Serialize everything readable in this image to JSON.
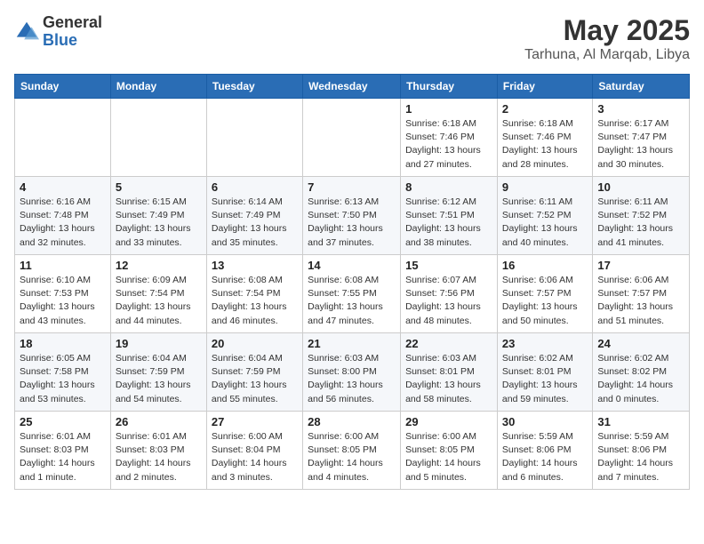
{
  "header": {
    "logo_general": "General",
    "logo_blue": "Blue",
    "title": "May 2025",
    "location": "Tarhuna, Al Marqab, Libya"
  },
  "weekdays": [
    "Sunday",
    "Monday",
    "Tuesday",
    "Wednesday",
    "Thursday",
    "Friday",
    "Saturday"
  ],
  "weeks": [
    [
      {
        "day": "",
        "info": ""
      },
      {
        "day": "",
        "info": ""
      },
      {
        "day": "",
        "info": ""
      },
      {
        "day": "",
        "info": ""
      },
      {
        "day": "1",
        "info": "Sunrise: 6:18 AM\nSunset: 7:46 PM\nDaylight: 13 hours\nand 27 minutes."
      },
      {
        "day": "2",
        "info": "Sunrise: 6:18 AM\nSunset: 7:46 PM\nDaylight: 13 hours\nand 28 minutes."
      },
      {
        "day": "3",
        "info": "Sunrise: 6:17 AM\nSunset: 7:47 PM\nDaylight: 13 hours\nand 30 minutes."
      }
    ],
    [
      {
        "day": "4",
        "info": "Sunrise: 6:16 AM\nSunset: 7:48 PM\nDaylight: 13 hours\nand 32 minutes."
      },
      {
        "day": "5",
        "info": "Sunrise: 6:15 AM\nSunset: 7:49 PM\nDaylight: 13 hours\nand 33 minutes."
      },
      {
        "day": "6",
        "info": "Sunrise: 6:14 AM\nSunset: 7:49 PM\nDaylight: 13 hours\nand 35 minutes."
      },
      {
        "day": "7",
        "info": "Sunrise: 6:13 AM\nSunset: 7:50 PM\nDaylight: 13 hours\nand 37 minutes."
      },
      {
        "day": "8",
        "info": "Sunrise: 6:12 AM\nSunset: 7:51 PM\nDaylight: 13 hours\nand 38 minutes."
      },
      {
        "day": "9",
        "info": "Sunrise: 6:11 AM\nSunset: 7:52 PM\nDaylight: 13 hours\nand 40 minutes."
      },
      {
        "day": "10",
        "info": "Sunrise: 6:11 AM\nSunset: 7:52 PM\nDaylight: 13 hours\nand 41 minutes."
      }
    ],
    [
      {
        "day": "11",
        "info": "Sunrise: 6:10 AM\nSunset: 7:53 PM\nDaylight: 13 hours\nand 43 minutes."
      },
      {
        "day": "12",
        "info": "Sunrise: 6:09 AM\nSunset: 7:54 PM\nDaylight: 13 hours\nand 44 minutes."
      },
      {
        "day": "13",
        "info": "Sunrise: 6:08 AM\nSunset: 7:54 PM\nDaylight: 13 hours\nand 46 minutes."
      },
      {
        "day": "14",
        "info": "Sunrise: 6:08 AM\nSunset: 7:55 PM\nDaylight: 13 hours\nand 47 minutes."
      },
      {
        "day": "15",
        "info": "Sunrise: 6:07 AM\nSunset: 7:56 PM\nDaylight: 13 hours\nand 48 minutes."
      },
      {
        "day": "16",
        "info": "Sunrise: 6:06 AM\nSunset: 7:57 PM\nDaylight: 13 hours\nand 50 minutes."
      },
      {
        "day": "17",
        "info": "Sunrise: 6:06 AM\nSunset: 7:57 PM\nDaylight: 13 hours\nand 51 minutes."
      }
    ],
    [
      {
        "day": "18",
        "info": "Sunrise: 6:05 AM\nSunset: 7:58 PM\nDaylight: 13 hours\nand 53 minutes."
      },
      {
        "day": "19",
        "info": "Sunrise: 6:04 AM\nSunset: 7:59 PM\nDaylight: 13 hours\nand 54 minutes."
      },
      {
        "day": "20",
        "info": "Sunrise: 6:04 AM\nSunset: 7:59 PM\nDaylight: 13 hours\nand 55 minutes."
      },
      {
        "day": "21",
        "info": "Sunrise: 6:03 AM\nSunset: 8:00 PM\nDaylight: 13 hours\nand 56 minutes."
      },
      {
        "day": "22",
        "info": "Sunrise: 6:03 AM\nSunset: 8:01 PM\nDaylight: 13 hours\nand 58 minutes."
      },
      {
        "day": "23",
        "info": "Sunrise: 6:02 AM\nSunset: 8:01 PM\nDaylight: 13 hours\nand 59 minutes."
      },
      {
        "day": "24",
        "info": "Sunrise: 6:02 AM\nSunset: 8:02 PM\nDaylight: 14 hours\nand 0 minutes."
      }
    ],
    [
      {
        "day": "25",
        "info": "Sunrise: 6:01 AM\nSunset: 8:03 PM\nDaylight: 14 hours\nand 1 minute."
      },
      {
        "day": "26",
        "info": "Sunrise: 6:01 AM\nSunset: 8:03 PM\nDaylight: 14 hours\nand 2 minutes."
      },
      {
        "day": "27",
        "info": "Sunrise: 6:00 AM\nSunset: 8:04 PM\nDaylight: 14 hours\nand 3 minutes."
      },
      {
        "day": "28",
        "info": "Sunrise: 6:00 AM\nSunset: 8:05 PM\nDaylight: 14 hours\nand 4 minutes."
      },
      {
        "day": "29",
        "info": "Sunrise: 6:00 AM\nSunset: 8:05 PM\nDaylight: 14 hours\nand 5 minutes."
      },
      {
        "day": "30",
        "info": "Sunrise: 5:59 AM\nSunset: 8:06 PM\nDaylight: 14 hours\nand 6 minutes."
      },
      {
        "day": "31",
        "info": "Sunrise: 5:59 AM\nSunset: 8:06 PM\nDaylight: 14 hours\nand 7 minutes."
      }
    ]
  ]
}
